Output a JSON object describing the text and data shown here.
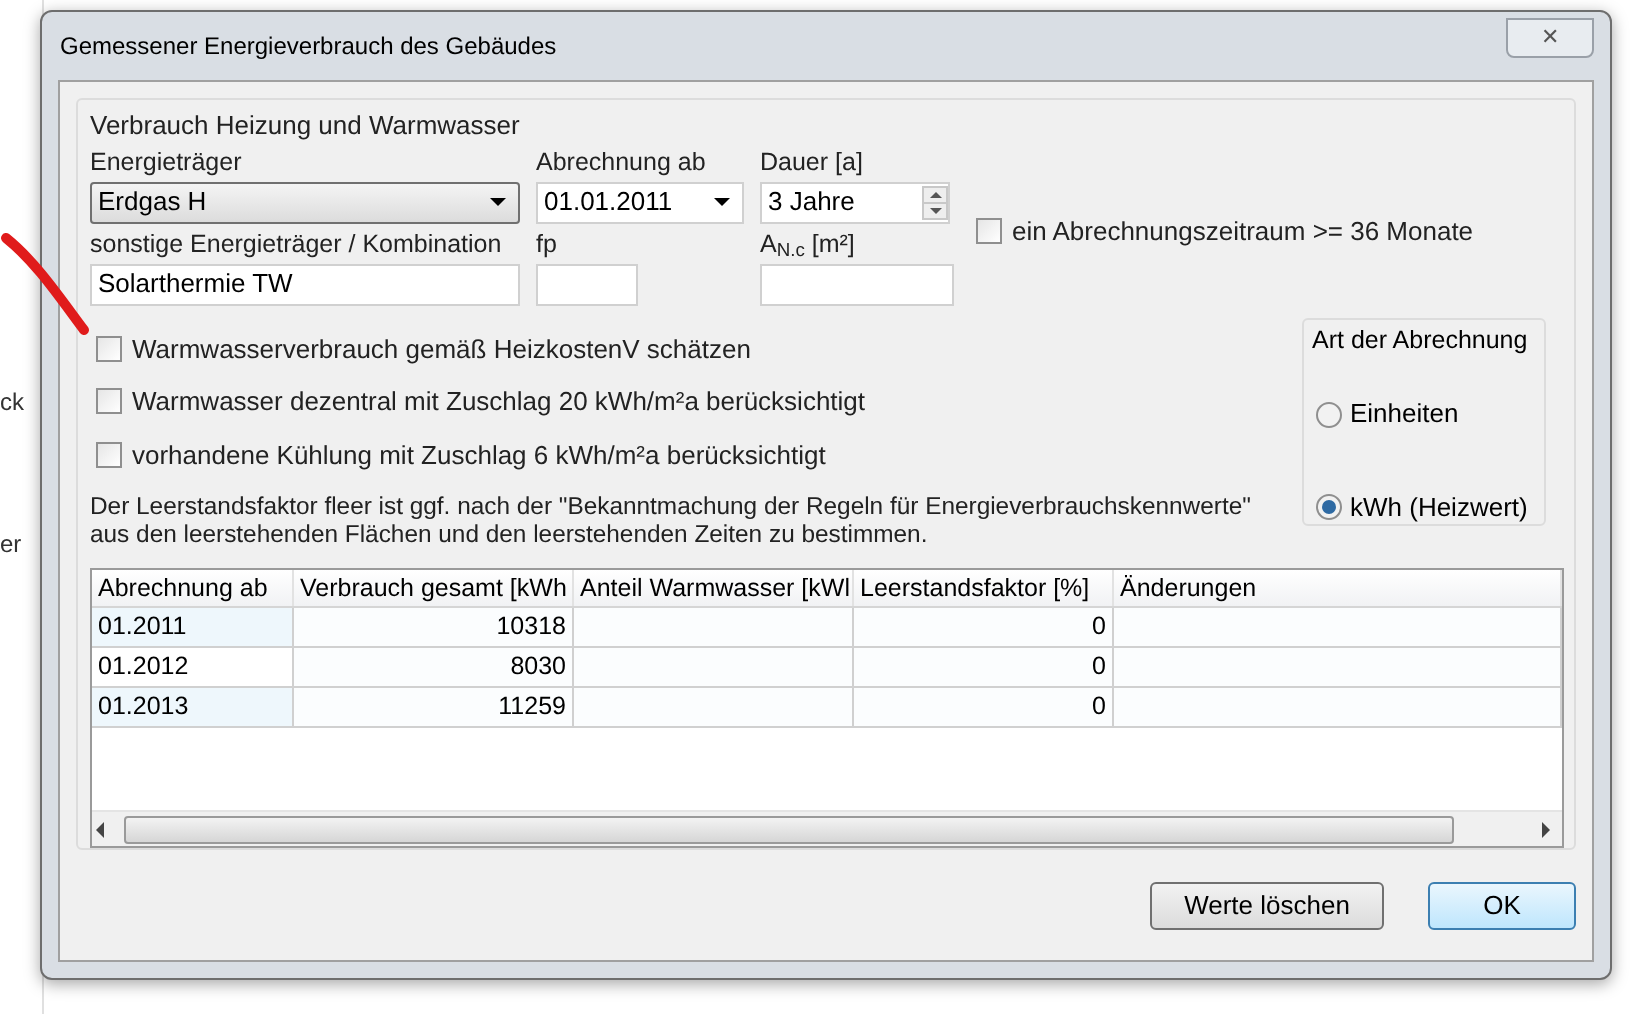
{
  "background_window": {
    "texts": [
      "ck",
      "er"
    ]
  },
  "window": {
    "title": "Gemessener Energieverbrauch des Gebäudes",
    "close": "✕"
  },
  "group": {
    "title": "Verbrauch Heizung und Warmwasser"
  },
  "fields": {
    "energietraeger": {
      "label": "Energieträger",
      "value": "Erdgas H"
    },
    "abrechnung_ab": {
      "label": "Abrechnung ab",
      "value": "01.01.2011"
    },
    "dauer": {
      "label": "Dauer [a]",
      "value": "3 Jahre"
    },
    "sonstige": {
      "label": "sonstige Energieträger / Kombination",
      "value": "Solarthermie TW"
    },
    "fp": {
      "label": "fp"
    },
    "anc": {
      "label": "A$_{N.c}$ [m²]"
    }
  },
  "zeitraum_checkbox": {
    "label": "ein Abrechnungszeitraum >= 36 Monate",
    "checked": false
  },
  "checkboxes": [
    {
      "label": "Warmwasserverbrauch gemäß HeizkostenV schätzen",
      "checked": false
    },
    {
      "label": "Warmwasser dezentral mit Zuschlag 20 kWh/m²a berücksichtigt",
      "checked": false
    },
    {
      "label": "vorhandene Kühlung mit Zuschlag 6 kWh/m²a berücksichtigt",
      "checked": false
    }
  ],
  "radio_group": {
    "title": "Art der Abrechnung",
    "options": [
      {
        "label": "Einheiten",
        "selected": false
      },
      {
        "label": "kWh (Heizwert)",
        "selected": true
      }
    ]
  },
  "note": "Der Leerstandsfaktor fleer ist ggf. nach der \"Bekanntmachung der Regeln für Energieverbrauchskennwerte\" aus den leerstehenden Flächen und den leerstehenden Zeiten zu bestimmen.",
  "table": {
    "columns": [
      "Abrechnung ab",
      "Verbrauch gesamt [kWh",
      "Anteil Warmwasser [kWl",
      "Leerstandsfaktor [%]",
      "Änderungen"
    ],
    "rows": [
      [
        "01.2011",
        "10318",
        "",
        "0",
        ""
      ],
      [
        "01.2012",
        "8030",
        "",
        "0",
        ""
      ],
      [
        "01.2013",
        "11259",
        "",
        "0",
        ""
      ]
    ]
  },
  "buttons": [
    {
      "label": "Werte löschen",
      "kind": "normal"
    },
    {
      "label": "OK",
      "kind": "default"
    }
  ]
}
